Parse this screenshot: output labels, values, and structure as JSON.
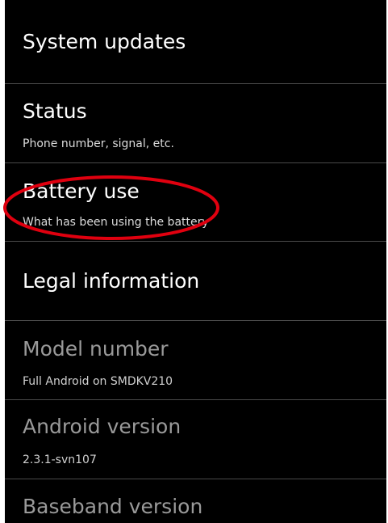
{
  "settings": {
    "items": [
      {
        "title": "System updates",
        "subtitle": "",
        "enabled": true
      },
      {
        "title": "Status",
        "subtitle": "Phone number, signal, etc.",
        "enabled": true
      },
      {
        "title": "Battery use",
        "subtitle": "What has been using the battery",
        "enabled": true
      },
      {
        "title": "Legal information",
        "subtitle": "",
        "enabled": true
      },
      {
        "title": "Model number",
        "subtitle": "Full Android on SMDKV210",
        "enabled": false
      },
      {
        "title": "Android version",
        "subtitle": "2.3.1-svn107",
        "enabled": false
      },
      {
        "title": "Baseband version",
        "subtitle": "",
        "enabled": false
      }
    ]
  },
  "annotation": {
    "target": "Battery use",
    "color": "#e0000f"
  }
}
